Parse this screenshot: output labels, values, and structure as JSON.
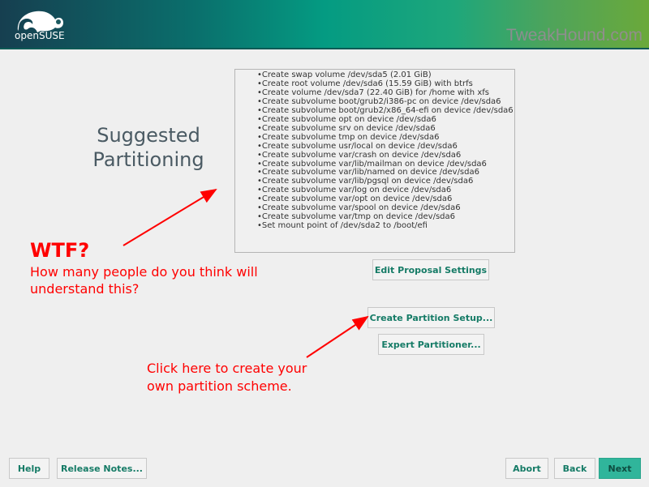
{
  "header": {
    "brand": "openSUSE",
    "watermark": "TweakHound.com"
  },
  "page_title": [
    "Suggested",
    "Partitioning"
  ],
  "proposal": [
    "Create swap volume /dev/sda5 (2.01 GiB)",
    "Create root volume /dev/sda6 (15.59 GiB) with btrfs",
    "Create volume /dev/sda7 (22.40 GiB) for /home with xfs",
    "Create subvolume boot/grub2/i386-pc on device /dev/sda6",
    "Create subvolume boot/grub2/x86_64-efi on device /dev/sda6",
    "Create subvolume opt on device /dev/sda6",
    "Create subvolume srv on device /dev/sda6",
    "Create subvolume tmp on device /dev/sda6",
    "Create subvolume usr/local on device /dev/sda6",
    "Create subvolume var/crash on device /dev/sda6",
    "Create subvolume var/lib/mailman on device /dev/sda6",
    "Create subvolume var/lib/named on device /dev/sda6",
    "Create subvolume var/lib/pgsql on device /dev/sda6",
    "Create subvolume var/log on device /dev/sda6",
    "Create subvolume var/opt on device /dev/sda6",
    "Create subvolume var/spool on device /dev/sda6",
    "Create subvolume var/tmp on device /dev/sda6",
    "Set mount point of /dev/sda2 to /boot/efi"
  ],
  "buttons": {
    "edit_proposal": "Edit Proposal Settings",
    "create_setup": "Create Partition Setup...",
    "expert": "Expert Partitioner...",
    "help": "Help",
    "release_notes": "Release Notes...",
    "abort": "Abort",
    "back": "Back",
    "next": "Next"
  },
  "annotations": {
    "wtf": "WTF?",
    "question": [
      "How many people do you think will",
      "understand this?"
    ],
    "hint": [
      "Click here to create your",
      "own partition scheme."
    ]
  },
  "colors": {
    "accent": "#30b59b",
    "annotation": "#ff0000"
  }
}
